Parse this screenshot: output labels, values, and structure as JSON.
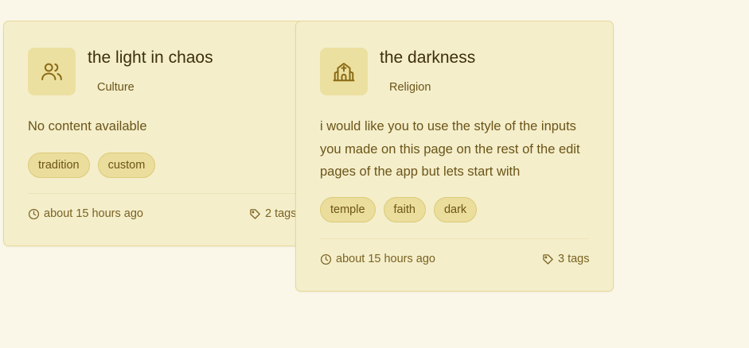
{
  "cards": [
    {
      "title": "the light in chaos",
      "category": "Culture",
      "icon": "users-icon",
      "content": "No content available",
      "tags": [
        "tradition",
        "custom"
      ],
      "updated": "about 15 hours ago",
      "tag_count": "2 tags"
    },
    {
      "title": "the darkness",
      "category": "Religion",
      "icon": "church-icon",
      "content": "i would like you to use the style of the inputs you made on this page on the rest of the edit pages of the app but lets start with",
      "tags": [
        "temple",
        "faith",
        "dark"
      ],
      "updated": "about 15 hours ago",
      "tag_count": "3 tags"
    }
  ],
  "colors": {
    "background": "#faf7e9",
    "card": "#f4eecb",
    "accent": "#8a6a14"
  }
}
